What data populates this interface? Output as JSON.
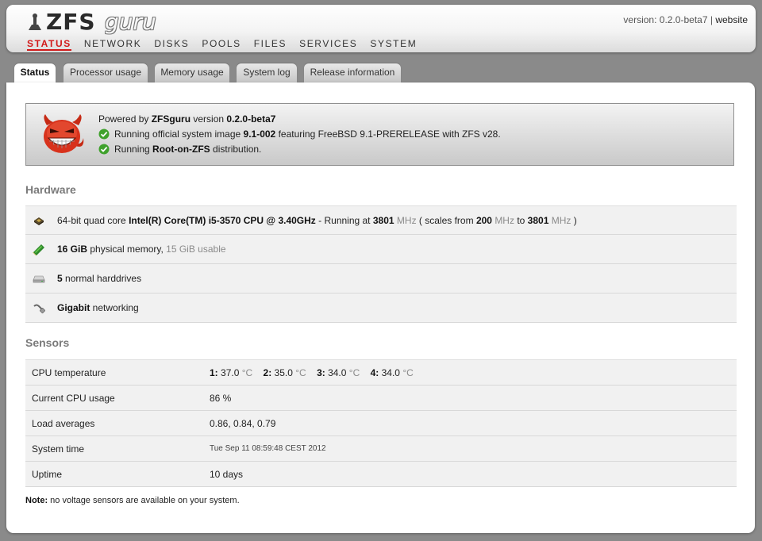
{
  "brand": {
    "logo_main": "ZFS",
    "logo_sub": "guru"
  },
  "nav": {
    "items": [
      "STATUS",
      "NETWORK",
      "DISKS",
      "POOLS",
      "FILES",
      "SERVICES",
      "SYSTEM"
    ],
    "active": "STATUS"
  },
  "version": {
    "prefix": "version:",
    "value": "0.2.0-beta7",
    "separator": "|",
    "link": "website"
  },
  "tabs": [
    "Status",
    "Processor usage",
    "Memory usage",
    "System log",
    "Release information"
  ],
  "powered": {
    "line1": {
      "pre": "Powered by ",
      "product": "ZFSguru",
      "mid": " version ",
      "version": "0.2.0-beta7"
    },
    "line2": {
      "pre": "Running official system image ",
      "image": "9.1-002",
      "post": " featuring FreeBSD 9.1-PRERELEASE with ZFS v28."
    },
    "line3": {
      "pre": "Running ",
      "dist": "Root-on-ZFS",
      "post": " distribution."
    }
  },
  "hardware": {
    "title": "Hardware",
    "cpu": {
      "pre": "64-bit quad core ",
      "model": "Intel(R) Core(TM) i5-3570 CPU @ 3.40GHz",
      "running": " - Running at ",
      "freq": "3801",
      "unit": "MHz",
      "scales_pre": " ( scales from ",
      "min": "200",
      "to": " to ",
      "max": "3801",
      "close": " )"
    },
    "memory": {
      "amount": "16 GiB",
      "label": " physical memory, ",
      "usable": "15 GiB usable"
    },
    "disks": {
      "count": "5",
      "label": " normal harddrives"
    },
    "network": {
      "speed": "Gigabit",
      "label": " networking"
    }
  },
  "sensors": {
    "title": "Sensors",
    "temperature": {
      "label": "CPU temperature",
      "unit": "°C",
      "cores": [
        {
          "id": "1:",
          "value": "37.0"
        },
        {
          "id": "2:",
          "value": "35.0"
        },
        {
          "id": "3:",
          "value": "34.0"
        },
        {
          "id": "4:",
          "value": "34.0"
        }
      ]
    },
    "cpu_usage": {
      "label": "Current CPU usage",
      "value": "86 %"
    },
    "load": {
      "label": "Load averages",
      "value": "0.86, 0.84, 0.79"
    },
    "time": {
      "label": "System time",
      "value": "Tue Sep 11 08:59:48 CEST 2012"
    },
    "uptime": {
      "label": "Uptime",
      "value": "10 days"
    }
  },
  "note": {
    "label": "Note:",
    "text": " no voltage sensors are available on your system."
  },
  "colors": {
    "active_nav": "#d21a1a",
    "row_bg": "#f1f1f1",
    "check_green": "#3fa12c",
    "devil_red": "#d8321c"
  }
}
